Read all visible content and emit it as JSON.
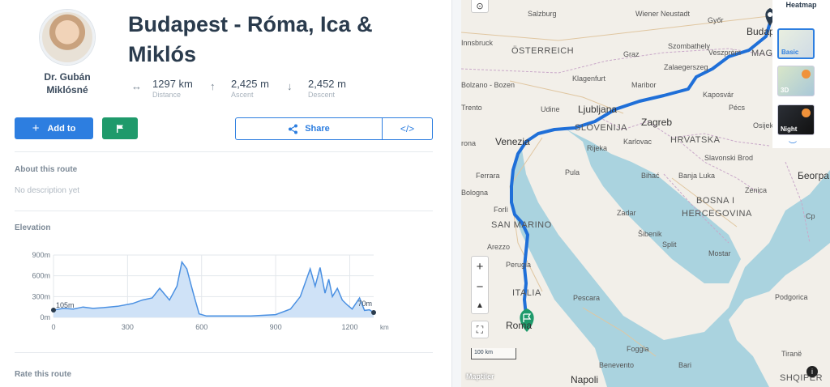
{
  "author": {
    "name": "Dr. Gubán Miklósné"
  },
  "route": {
    "title": "Budapest - Róma, Ica & Miklós",
    "stats": [
      {
        "icon": "distance-icon",
        "glyph": "↔",
        "value": "1297 km",
        "label": "Distance"
      },
      {
        "icon": "ascent-icon",
        "glyph": "↑",
        "value": "2,425 m",
        "label": "Ascent"
      },
      {
        "icon": "descent-icon",
        "glyph": "↓",
        "value": "2,452 m",
        "label": "Descent"
      }
    ]
  },
  "actions": {
    "add_label": "Add to",
    "share_label": "Share",
    "embed_glyph": "</>"
  },
  "about": {
    "title": "About this route",
    "description": "No description yet"
  },
  "elevation": {
    "title": "Elevation",
    "start_label": "105m",
    "end_label": "70m",
    "chart_data": {
      "type": "area",
      "x": [
        0,
        40,
        80,
        120,
        160,
        200,
        260,
        320,
        360,
        400,
        430,
        470,
        500,
        520,
        540,
        555,
        570,
        590,
        620,
        700,
        800,
        900,
        960,
        1000,
        1040,
        1060,
        1080,
        1100,
        1115,
        1130,
        1150,
        1170,
        1190,
        1210,
        1240,
        1260,
        1280,
        1297
      ],
      "y": [
        105,
        130,
        120,
        150,
        130,
        140,
        160,
        200,
        250,
        280,
        420,
        250,
        450,
        800,
        700,
        500,
        300,
        50,
        20,
        20,
        20,
        40,
        120,
        300,
        700,
        450,
        720,
        350,
        550,
        300,
        420,
        250,
        180,
        120,
        280,
        100,
        110,
        70
      ],
      "xlabel": "km",
      "x_ticks": [
        "0",
        "300",
        "600",
        "900",
        "1200"
      ],
      "y_ticks": [
        "0m",
        "300m",
        "600m",
        "900m"
      ],
      "xlim": [
        0,
        1297
      ],
      "ylim": [
        0,
        900
      ],
      "grid": true
    }
  },
  "rate": {
    "title": "Rate this route"
  },
  "map": {
    "heatmap_label": "Heatmap",
    "layers": [
      {
        "name": "layer-basic",
        "label": "Basic",
        "color": "#2d7ee0"
      },
      {
        "name": "layer-3d",
        "label": "3D",
        "color": "#ffffff"
      },
      {
        "name": "layer-night",
        "label": "Night",
        "color": "#ffffff"
      }
    ],
    "zoom_in": "+",
    "zoom_out": "−",
    "scale_label": "100 km",
    "attribution": "Maptiler",
    "countries": [
      "ÖSTERREICH",
      "SLOVENIJA",
      "HRVATSKA",
      "BOSNA I",
      "HERCEGOVINA",
      "SAN MARINO",
      "ITALIA",
      "MAGY"
    ],
    "cities": {
      "salzburg": "Salzburg",
      "wien": "Wiener Neustadt",
      "gyor": "Győr",
      "buda": "Budap",
      "innsbruck": "Innsbruck",
      "szombathely": "Szombathely",
      "veszprem": "Veszprém",
      "graz": "Graz",
      "zalaegerszeg": "Zalaegerszeg",
      "bolzano": "Bolzano - Bozen",
      "klagenfurt": "Klagenfurt",
      "maribor": "Maribor",
      "kaposvar": "Kaposvár",
      "trento": "Trento",
      "udine": "Udine",
      "ljubljana": "Ljubljana",
      "pecs": "Pécs",
      "zagreb": "Zagreb",
      "osijek": "Osijek",
      "verona": "rona",
      "venezia": "Venezia",
      "rijeka": "Rijeka",
      "karlovac": "Karlovac",
      "slavonski": "Slavonski Brod",
      "beograd": "Београ",
      "ferrara": "Ferrara",
      "pula": "Pula",
      "bihac": "Bihać",
      "banjaluka": "Banja Luka",
      "bologna": "Bologna",
      "forli": "Forlì",
      "zadar": "Zadar",
      "sibenik": "Šibenik",
      "split": "Split",
      "mostar": "Mostar",
      "arezzo": "Arezzo",
      "perugia": "Perugia",
      "roma": "Roma",
      "pescara": "Pescara",
      "foggia": "Foggia",
      "podgorica": "Podgorica",
      "bari": "Bari",
      "benevento": "Benevento",
      "napoli": "Napoli",
      "tirane": "Tiranë",
      "shqiperi": "SHQIPËR",
      "zenica": "Zenica",
      "cp": "Ср"
    }
  }
}
